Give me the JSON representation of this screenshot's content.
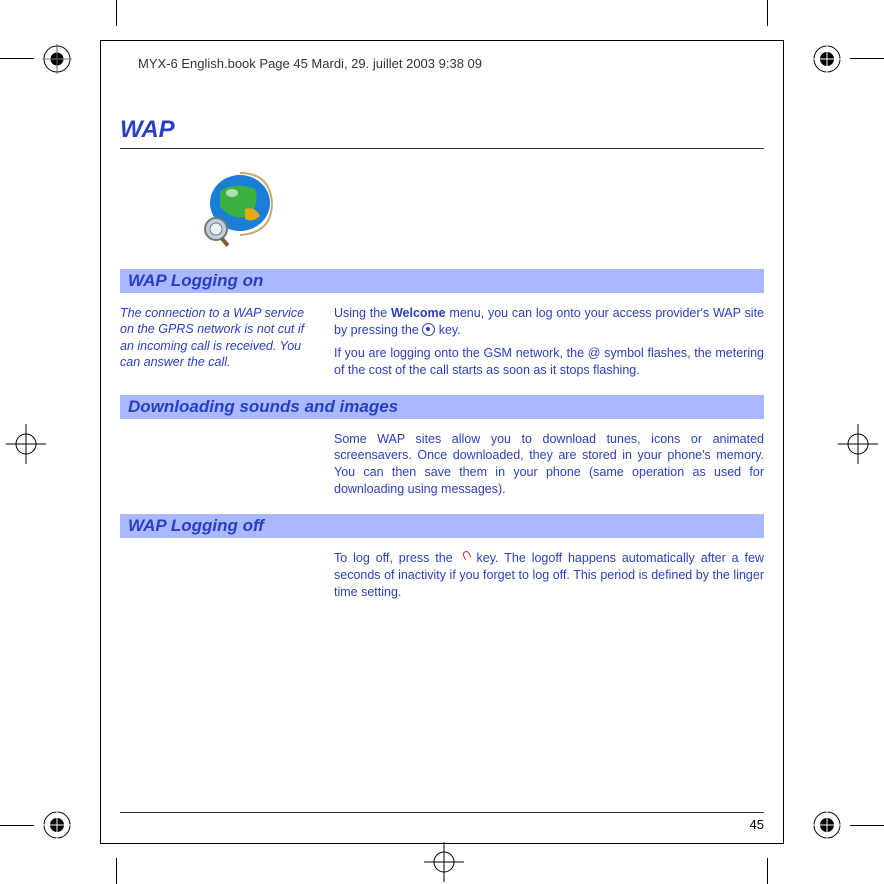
{
  "running_head": "MYX-6 English.book  Page 45  Mardi, 29. juillet 2003  9:38 09",
  "chapter_title": "WAP",
  "page_number": "45",
  "sections": {
    "logon": {
      "heading": "WAP Logging on",
      "sidenote": "The connection to a WAP service on the GPRS network is not cut if an incoming call is received. You can answer the call.",
      "body_p1_a": "Using the ",
      "body_p1_bold": "Welcome",
      "body_p1_b": " menu, you can log onto your access provider's WAP site by pressing the ",
      "body_p1_c": " key.",
      "body_p2": "If you are logging onto the GSM network, the @ symbol flashes, the metering of the cost of the call starts as soon as it stops flashing."
    },
    "download": {
      "heading": "Downloading sounds and images",
      "body": "Some WAP sites allow you to download tunes, icons or animated screensavers. Once downloaded, they are stored in your phone's memory. You can then save them in your phone (same operation as used for downloading using messages)."
    },
    "logoff": {
      "heading": "WAP Logging off",
      "body_a": "To log off, press the ",
      "body_b": " key. The logoff happens automatically after a few seconds of inactivity if you forget to log off. This period is defined by the linger time setting."
    }
  }
}
